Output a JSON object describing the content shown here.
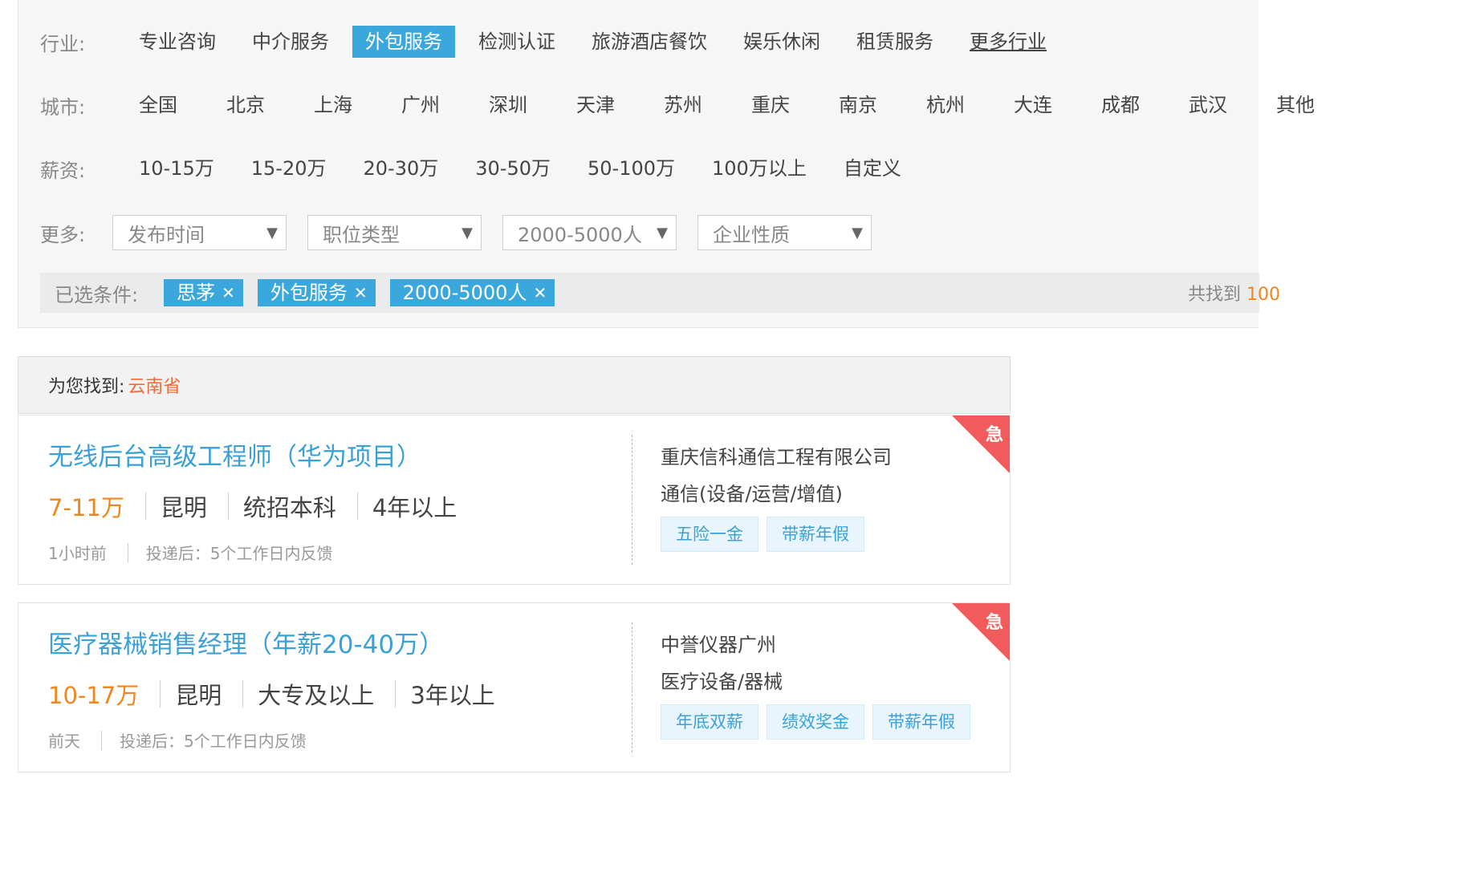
{
  "filters": {
    "industry": {
      "label": "行业:",
      "options": [
        "专业咨询",
        "中介服务",
        "外包服务",
        "检测认证",
        "旅游酒店餐饮",
        "娱乐休闲",
        "租赁服务"
      ],
      "selected": "外包服务",
      "more": "更多行业"
    },
    "city": {
      "label": "城市:",
      "options": [
        "全国",
        "北京",
        "上海",
        "广州",
        "深圳",
        "天津",
        "苏州",
        "重庆",
        "南京",
        "杭州",
        "大连",
        "成都",
        "武汉",
        "其他"
      ]
    },
    "salary": {
      "label": "薪资:",
      "options": [
        "10-15万",
        "15-20万",
        "20-30万",
        "30-50万",
        "50-100万",
        "100万以上",
        "自定义"
      ]
    },
    "more": {
      "label": "更多:",
      "dropdowns": [
        "发布时间",
        "职位类型",
        "2000-5000人",
        "企业性质"
      ]
    }
  },
  "selected_conditions": {
    "label": "已选条件:",
    "tags": [
      "思茅",
      "外包服务",
      "2000-5000人"
    ],
    "found_prefix": "共找到",
    "found_count": "100"
  },
  "results": {
    "label": "为您找到:",
    "location": "云南省"
  },
  "jobs": [
    {
      "title": "无线后台高级工程师（华为项目）",
      "salary": "7-11万",
      "city": "昆明",
      "education": "统招本科",
      "experience": "4年以上",
      "posted": "1小时前",
      "feedback": "投递后：5个工作日内反馈",
      "company": "重庆信科通信工程有限公司",
      "industry": "通信(设备/运营/增值)",
      "benefits": [
        "五险一金",
        "带薪年假"
      ],
      "urgent": "急"
    },
    {
      "title": "医疗器械销售经理（年薪20-40万）",
      "salary": "10-17万",
      "city": "昆明",
      "education": "大专及以上",
      "experience": "3年以上",
      "posted": "前天",
      "feedback": "投递后：5个工作日内反馈",
      "company": "中誉仪器广州",
      "industry": "医疗设备/器械",
      "benefits": [
        "年底双薪",
        "绩效奖金",
        "带薪年假"
      ],
      "urgent": "急"
    }
  ],
  "colors": {
    "accent": "#3aa8dd",
    "salary": "#f0861e",
    "urgent": "#f25b5b",
    "location": "#f06a3a"
  }
}
